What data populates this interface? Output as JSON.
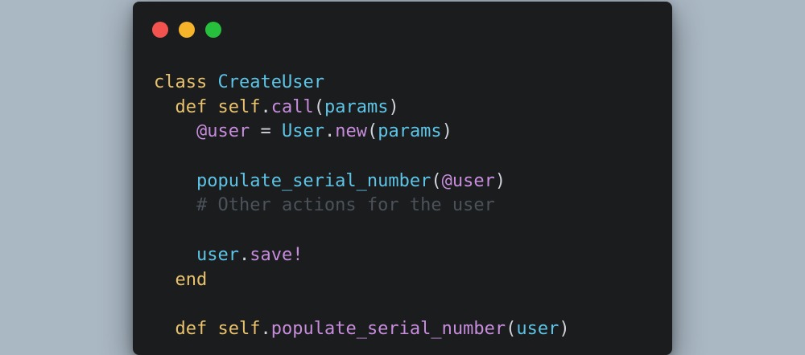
{
  "window": {
    "traffic_lights": {
      "close_color": "#f2534e",
      "minimize_color": "#f5b42a",
      "zoom_color": "#27c03c"
    }
  },
  "editor": {
    "language": "ruby",
    "lines": [
      [
        {
          "t": "class",
          "c": "kw"
        },
        {
          "t": " ",
          "c": "punc"
        },
        {
          "t": "CreateUser",
          "c": "cls"
        }
      ],
      [
        {
          "t": "  ",
          "c": "punc"
        },
        {
          "t": "def",
          "c": "kw"
        },
        {
          "t": " ",
          "c": "punc"
        },
        {
          "t": "self",
          "c": "kw"
        },
        {
          "t": ".",
          "c": "punc"
        },
        {
          "t": "call",
          "c": "meth"
        },
        {
          "t": "(",
          "c": "punc"
        },
        {
          "t": "params",
          "c": "var"
        },
        {
          "t": ")",
          "c": "punc"
        }
      ],
      [
        {
          "t": "    ",
          "c": "punc"
        },
        {
          "t": "@user",
          "c": "ivar"
        },
        {
          "t": " = ",
          "c": "op"
        },
        {
          "t": "User",
          "c": "cls"
        },
        {
          "t": ".",
          "c": "punc"
        },
        {
          "t": "new",
          "c": "meth"
        },
        {
          "t": "(",
          "c": "punc"
        },
        {
          "t": "params",
          "c": "var"
        },
        {
          "t": ")",
          "c": "punc"
        }
      ],
      [],
      [
        {
          "t": "    ",
          "c": "punc"
        },
        {
          "t": "populate_serial_number",
          "c": "fn"
        },
        {
          "t": "(",
          "c": "punc"
        },
        {
          "t": "@user",
          "c": "ivar"
        },
        {
          "t": ")",
          "c": "punc"
        }
      ],
      [
        {
          "t": "    ",
          "c": "punc"
        },
        {
          "t": "# Other actions for the user",
          "c": "comment"
        }
      ],
      [],
      [
        {
          "t": "    ",
          "c": "punc"
        },
        {
          "t": "user",
          "c": "var"
        },
        {
          "t": ".",
          "c": "punc"
        },
        {
          "t": "save!",
          "c": "meth"
        }
      ],
      [
        {
          "t": "  ",
          "c": "punc"
        },
        {
          "t": "end",
          "c": "kw"
        }
      ],
      [],
      [
        {
          "t": "  ",
          "c": "punc"
        },
        {
          "t": "def",
          "c": "kw"
        },
        {
          "t": " ",
          "c": "punc"
        },
        {
          "t": "self",
          "c": "kw"
        },
        {
          "t": ".",
          "c": "punc"
        },
        {
          "t": "populate_serial_number",
          "c": "meth"
        },
        {
          "t": "(",
          "c": "punc"
        },
        {
          "t": "user",
          "c": "var"
        },
        {
          "t": ")",
          "c": "punc"
        }
      ]
    ]
  }
}
